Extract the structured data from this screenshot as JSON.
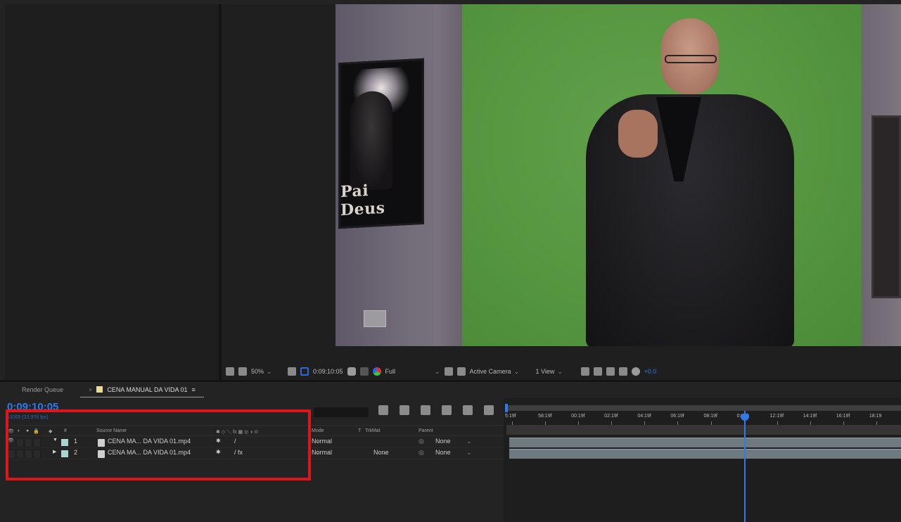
{
  "viewer": {
    "zoom": "50%",
    "timecode": "0:09:10:05",
    "resolution": "Full",
    "camera": "Active Camera",
    "views": "1 View",
    "exposure": "+0.0",
    "poster_text": "Pai Deus"
  },
  "tabs": {
    "render_queue": "Render Queue",
    "comp_name": "CENA MANUAL DA VIDA 01",
    "close": "×",
    "menu": "≡"
  },
  "timeline": {
    "timecode": "0:09:10:05",
    "fps": "13205 (23.976 fps)",
    "headers": {
      "num": "#",
      "source_name": "Source Name",
      "mode": "Mode",
      "t": "T",
      "trkmat": "TrkMat",
      "parent": "Parent"
    },
    "layers": [
      {
        "num": "1",
        "caret": "▼",
        "name": "CENA MA... DA VIDA 01.mp4",
        "mode": "Normal",
        "trkmat": "",
        "parent": "None",
        "fx": "/"
      },
      {
        "num": "2",
        "caret": "▶",
        "name": "CENA MA... DA VIDA 01.mp4",
        "mode": "Normal",
        "trkmat": "None",
        "parent": "None",
        "fx": "/ fx"
      }
    ],
    "ruler": [
      "5:19f",
      "58:19f",
      "00:19f",
      "02:19f",
      "04:19f",
      "06:19f",
      "08:19f",
      "0:19f",
      "12:19f",
      "14:19f",
      "16:19f",
      "18:19"
    ]
  },
  "colors": {
    "accent": "#2e7be8",
    "highlight_box": "#e0141b",
    "label_color": "#a8d4d2",
    "comp_swatch": "#e7dc98"
  }
}
